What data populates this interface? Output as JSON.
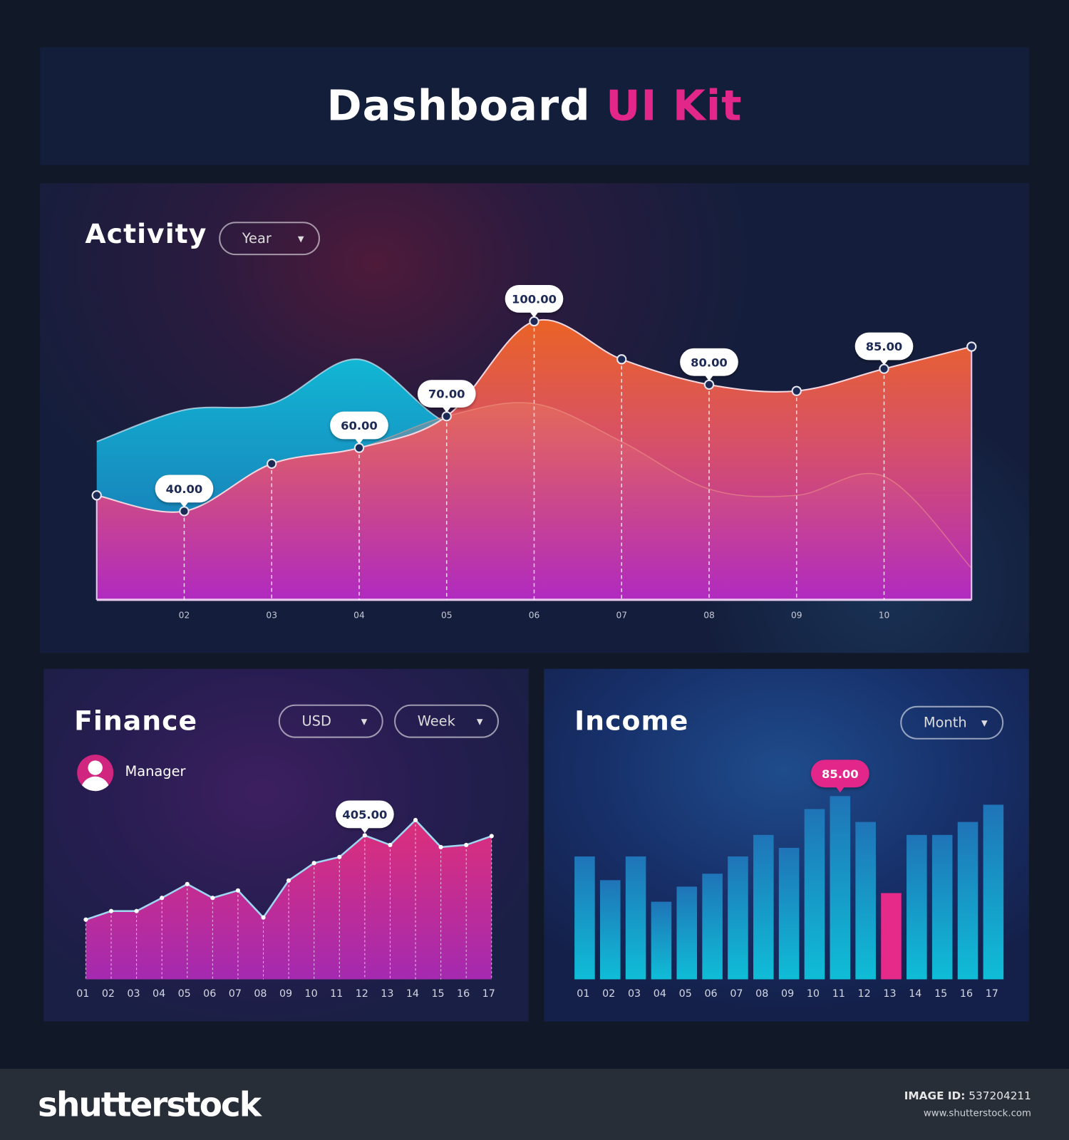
{
  "header": {
    "title_main": "Dashboard",
    "title_accent": "UI Kit",
    "accent_color": "#e3268a"
  },
  "activity": {
    "title": "Activity",
    "period_select": {
      "value": "Year",
      "icon": "caret-down-icon"
    }
  },
  "finance": {
    "title": "Finance",
    "currency_select": {
      "value": "USD",
      "icon": "caret-down-icon"
    },
    "period_select": {
      "value": "Week",
      "icon": "caret-down-icon"
    },
    "user": {
      "role": "Manager",
      "icon": "user-avatar-icon"
    }
  },
  "income": {
    "title": "Income",
    "period_select": {
      "value": "Month",
      "icon": "caret-down-icon"
    }
  },
  "footer": {
    "logo": "shutterstock",
    "image_id_label": "IMAGE ID:",
    "image_id": "537204211",
    "site": "www.shutterstock.com"
  },
  "chart_data": [
    {
      "id": "activity",
      "type": "area",
      "x": [
        1,
        2,
        3,
        4,
        5,
        6,
        7,
        8,
        9,
        10,
        11
      ],
      "x_tick_labels": [
        "02",
        "03",
        "04",
        "05",
        "06",
        "07",
        "08",
        "09",
        "10"
      ],
      "x_tick_positions": [
        2,
        3,
        4,
        5,
        6,
        7,
        8,
        9,
        10
      ],
      "ylim": [
        12,
        102
      ],
      "grid": false,
      "series": [
        {
          "values": [
            62,
            72,
            74,
            88,
            68,
            64,
            55,
            50,
            48,
            50,
            55
          ],
          "color": "#13b5d3"
        },
        {
          "values": [
            45,
            40,
            55,
            60,
            70,
            100,
            88,
            80,
            78,
            85,
            92
          ],
          "color": "#e8622a"
        },
        {
          "values": [
            45,
            40,
            55,
            60,
            70,
            74,
            62,
            47,
            45,
            51,
            22
          ],
          "color": "#e06a6a"
        }
      ],
      "annotations": [
        {
          "x": 2,
          "label": "40.00"
        },
        {
          "x": 4,
          "label": "60.00"
        },
        {
          "x": 5,
          "label": "70.00"
        },
        {
          "x": 6,
          "label": "100.00"
        },
        {
          "x": 8,
          "label": "80.00"
        },
        {
          "x": 10,
          "label": "85.00"
        }
      ]
    },
    {
      "id": "finance",
      "type": "area",
      "categories": [
        "01",
        "02",
        "03",
        "04",
        "05",
        "06",
        "07",
        "08",
        "09",
        "10",
        "11",
        "12",
        "13",
        "14",
        "15",
        "16",
        "17"
      ],
      "values": [
        168,
        192,
        192,
        229,
        268,
        229,
        250,
        174,
        278,
        327,
        344,
        405,
        378,
        448,
        372,
        378,
        403
      ],
      "ylim": [
        0,
        410
      ],
      "color": "#d8307a",
      "annotations": [
        {
          "category": "12",
          "label": "405.00"
        }
      ]
    },
    {
      "id": "income",
      "type": "bar",
      "categories": [
        "01",
        "02",
        "03",
        "04",
        "05",
        "06",
        "07",
        "08",
        "09",
        "10",
        "11",
        "12",
        "13",
        "14",
        "15",
        "16",
        "17"
      ],
      "values": [
        57,
        46,
        57,
        36,
        43,
        49,
        57,
        67,
        61,
        79,
        85,
        73,
        40,
        67,
        67,
        73,
        81
      ],
      "highlight": {
        "category": "13",
        "color": "#e52a8a"
      },
      "ylim": [
        0,
        85
      ],
      "bar_color": "#1a86c4",
      "annotations": [
        {
          "category": "11",
          "label": "85.00",
          "color": "#e3268a"
        }
      ]
    }
  ]
}
